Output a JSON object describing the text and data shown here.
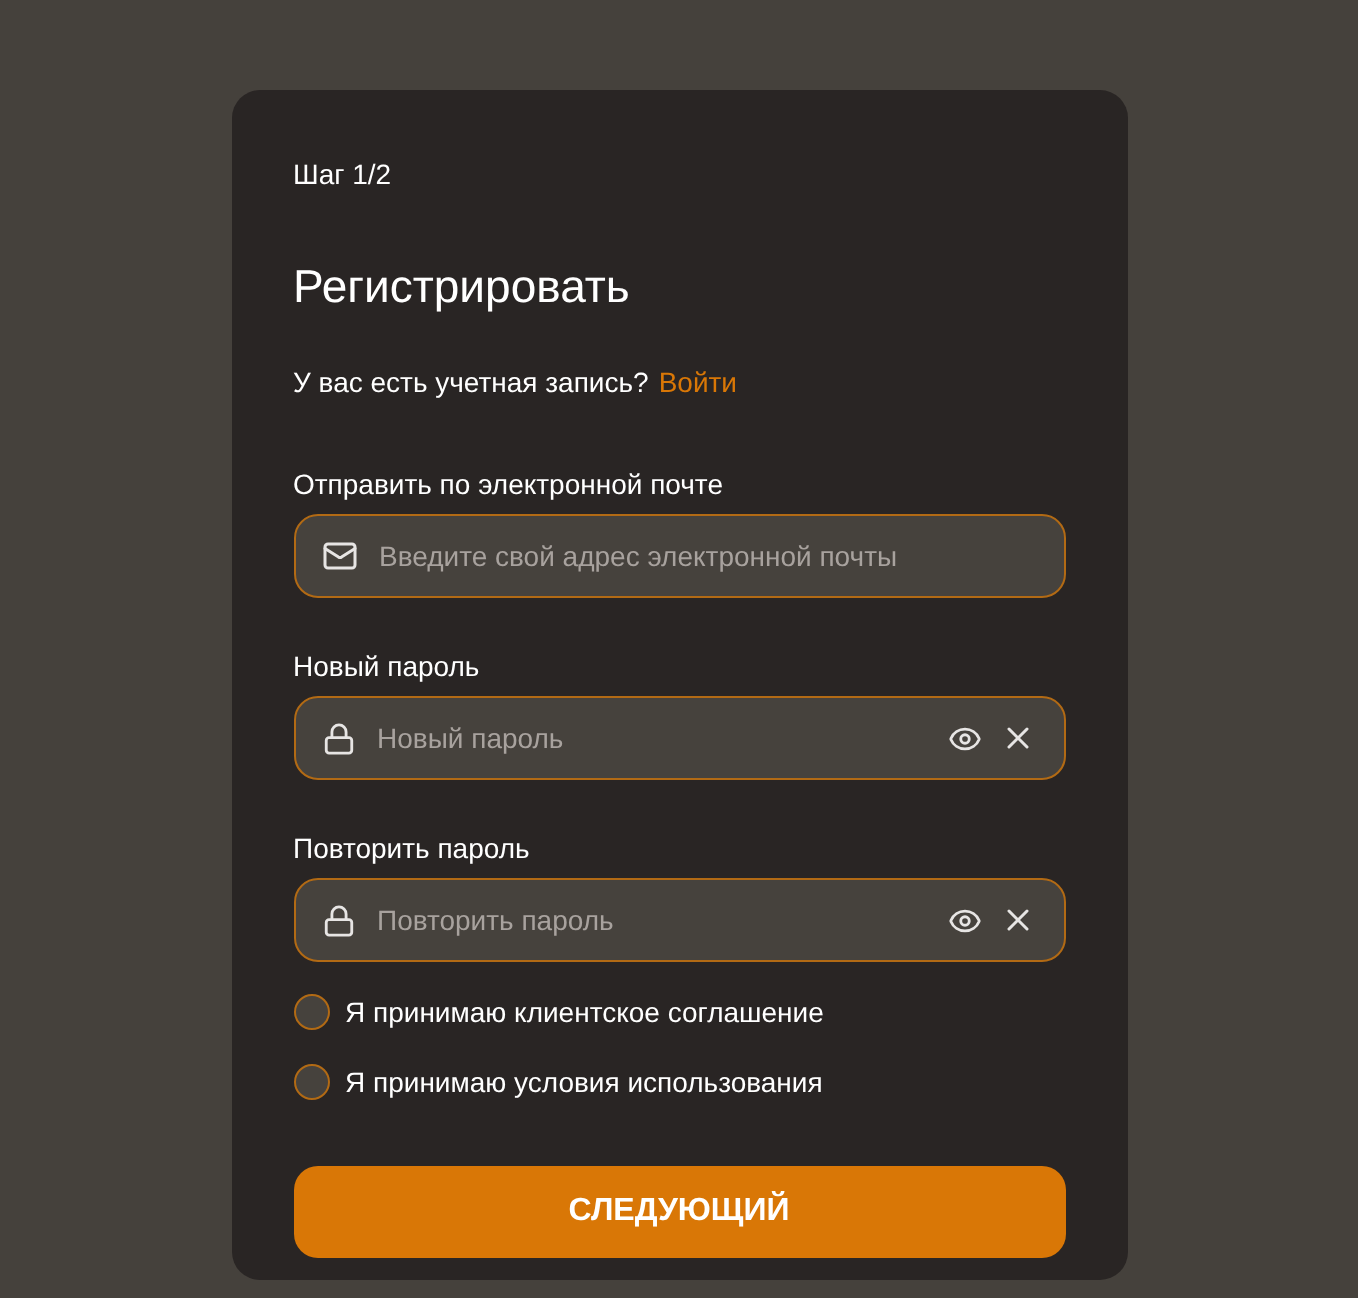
{
  "step": "Шаг 1/2",
  "title": "Регистрировать",
  "account": {
    "text": "У вас есть учетная запись?",
    "link": "Войти"
  },
  "fields": [
    {
      "kind": "email",
      "label": "Отправить по электронной почте",
      "placeholder": "Введите свой адрес электронной почты"
    },
    {
      "kind": "password",
      "label": "Новый пароль",
      "placeholder": "Новый пароль"
    },
    {
      "kind": "password",
      "label": "Повторить пароль",
      "placeholder": "Повторить пароль"
    }
  ],
  "agreements": [
    {
      "label": "Я принимаю клиентское соглашение",
      "checked": false
    },
    {
      "label": "Я принимаю условия использования",
      "checked": false
    }
  ],
  "submit": "СЛЕДУЮЩИЙ"
}
